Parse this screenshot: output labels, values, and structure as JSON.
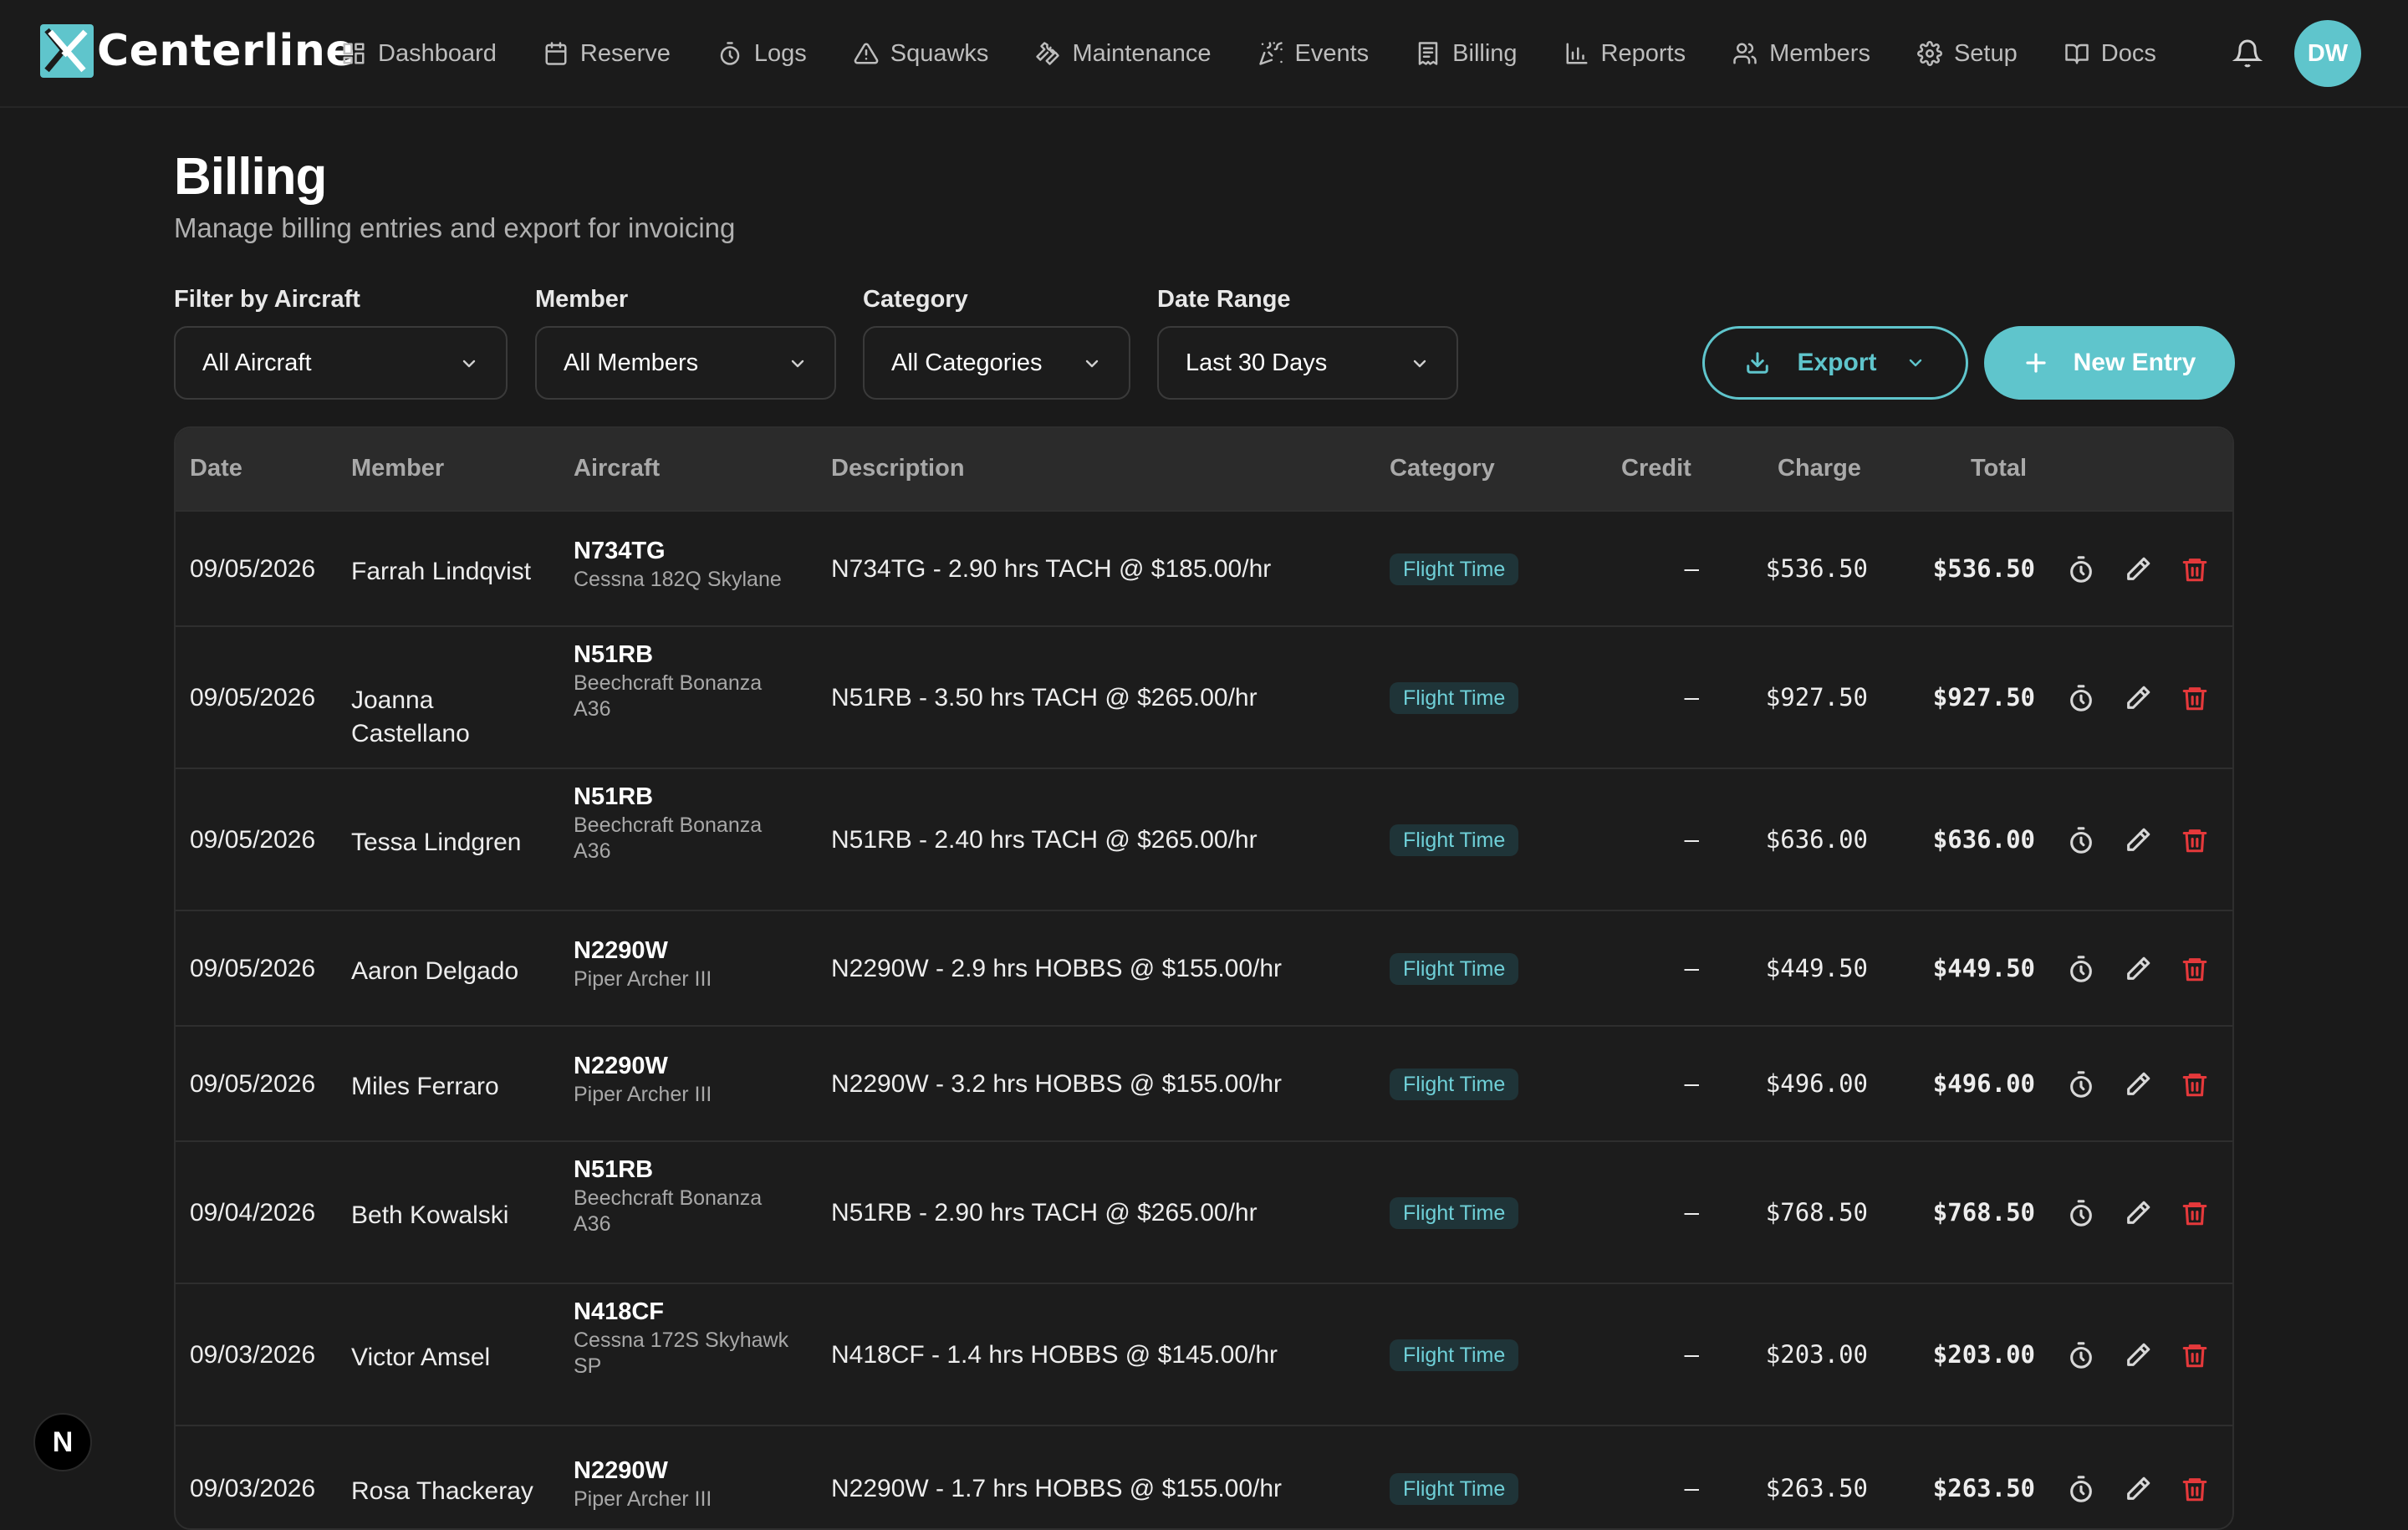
{
  "brand": {
    "name": "Centerline",
    "accent": "#5fc5cc",
    "danger": "#e5393b"
  },
  "nav": [
    {
      "label": "Dashboard",
      "icon": "dashboard-icon"
    },
    {
      "label": "Reserve",
      "icon": "calendar-icon"
    },
    {
      "label": "Logs",
      "icon": "stopwatch-icon"
    },
    {
      "label": "Squawks",
      "icon": "warning-icon"
    },
    {
      "label": "Maintenance",
      "icon": "wrench-icon"
    },
    {
      "label": "Events",
      "icon": "party-icon"
    },
    {
      "label": "Billing",
      "icon": "receipt-icon"
    },
    {
      "label": "Reports",
      "icon": "bar-chart-icon"
    },
    {
      "label": "Members",
      "icon": "users-icon"
    },
    {
      "label": "Setup",
      "icon": "gear-icon"
    },
    {
      "label": "Docs",
      "icon": "book-icon"
    }
  ],
  "user": {
    "initials": "DW"
  },
  "page": {
    "title": "Billing",
    "subtitle": "Manage billing entries and export for invoicing"
  },
  "filters": {
    "aircraft": {
      "label": "Filter by Aircraft",
      "value": "All Aircraft"
    },
    "member": {
      "label": "Member",
      "value": "All Members"
    },
    "category": {
      "label": "Category",
      "value": "All Categories"
    },
    "date_range": {
      "label": "Date Range",
      "value": "Last 30 Days"
    }
  },
  "actions": {
    "export": "Export",
    "new_entry": "New Entry"
  },
  "table": {
    "columns": [
      "Date",
      "Member",
      "Aircraft",
      "Description",
      "Category",
      "Credit",
      "Charge",
      "Total"
    ],
    "rows": [
      {
        "date": "09/05/2026",
        "member": "Farrah Lindqvist",
        "reg": "N734TG",
        "model": "Cessna 182Q Skylane",
        "desc": "N734TG - 2.90 hrs TACH @ $185.00/hr",
        "category": "Flight Time",
        "credit": "–",
        "charge": "$536.50",
        "total": "$536.50"
      },
      {
        "date": "09/05/2026",
        "member": "Joanna Castellano",
        "reg": "N51RB",
        "model": "Beechcraft Bonanza A36",
        "desc": "N51RB - 3.50 hrs TACH @ $265.00/hr",
        "category": "Flight Time",
        "credit": "–",
        "charge": "$927.50",
        "total": "$927.50"
      },
      {
        "date": "09/05/2026",
        "member": "Tessa Lindgren",
        "reg": "N51RB",
        "model": "Beechcraft Bonanza A36",
        "desc": "N51RB - 2.40 hrs TACH @ $265.00/hr",
        "category": "Flight Time",
        "credit": "–",
        "charge": "$636.00",
        "total": "$636.00"
      },
      {
        "date": "09/05/2026",
        "member": "Aaron Delgado",
        "reg": "N2290W",
        "model": "Piper Archer III",
        "desc": "N2290W - 2.9 hrs HOBBS @ $155.00/hr",
        "category": "Flight Time",
        "credit": "–",
        "charge": "$449.50",
        "total": "$449.50"
      },
      {
        "date": "09/05/2026",
        "member": "Miles Ferraro",
        "reg": "N2290W",
        "model": "Piper Archer III",
        "desc": "N2290W - 3.2 hrs HOBBS @ $155.00/hr",
        "category": "Flight Time",
        "credit": "–",
        "charge": "$496.00",
        "total": "$496.00"
      },
      {
        "date": "09/04/2026",
        "member": "Beth Kowalski",
        "reg": "N51RB",
        "model": "Beechcraft Bonanza A36",
        "desc": "N51RB - 2.90 hrs TACH @ $265.00/hr",
        "category": "Flight Time",
        "credit": "–",
        "charge": "$768.50",
        "total": "$768.50"
      },
      {
        "date": "09/03/2026",
        "member": "Victor Amsel",
        "reg": "N418CF",
        "model": "Cessna 172S Skyhawk SP",
        "desc": "N418CF - 1.4 hrs HOBBS @ $145.00/hr",
        "category": "Flight Time",
        "credit": "–",
        "charge": "$203.00",
        "total": "$203.00"
      },
      {
        "date": "09/03/2026",
        "member": "Rosa Thackeray",
        "reg": "N2290W",
        "model": "Piper Archer III",
        "desc": "N2290W - 1.7 hrs HOBBS @ $155.00/hr",
        "category": "Flight Time",
        "credit": "–",
        "charge": "$263.50",
        "total": "$263.50"
      }
    ]
  },
  "dev_badge": "N"
}
